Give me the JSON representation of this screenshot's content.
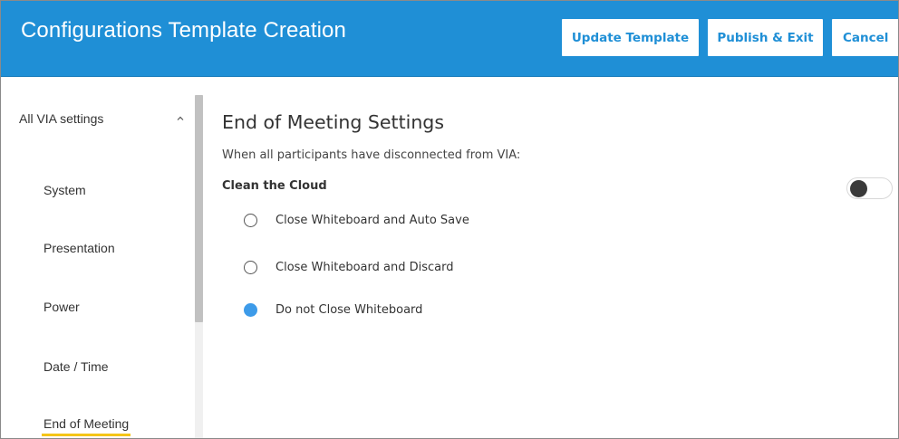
{
  "header": {
    "title": "Configurations Template Creation",
    "buttons": {
      "update": "Update Template",
      "publish": "Publish & Exit",
      "cancel": "Cancel"
    },
    "color": "#1f8fd6"
  },
  "sidebar": {
    "title": "All VIA settings",
    "expanded_icon": "chevron-up-icon",
    "items": [
      {
        "label": "System"
      },
      {
        "label": "Presentation"
      },
      {
        "label": "Power"
      },
      {
        "label": "Date / Time"
      },
      {
        "label": "End of Meeting",
        "active": true
      }
    ],
    "active_underline_color": "#f5c518"
  },
  "main": {
    "title": "End of Meeting Settings",
    "description": "When all participants have disconnected from VIA:",
    "section_label": "Clean the Cloud",
    "toggle_on": false,
    "options": [
      {
        "label": "Close Whiteboard and Auto Save",
        "selected": false
      },
      {
        "label": "Close Whiteboard and Discard",
        "selected": false
      },
      {
        "label": "Do not Close Whiteboard",
        "selected": true
      }
    ],
    "selected_color": "#3d9be9"
  }
}
